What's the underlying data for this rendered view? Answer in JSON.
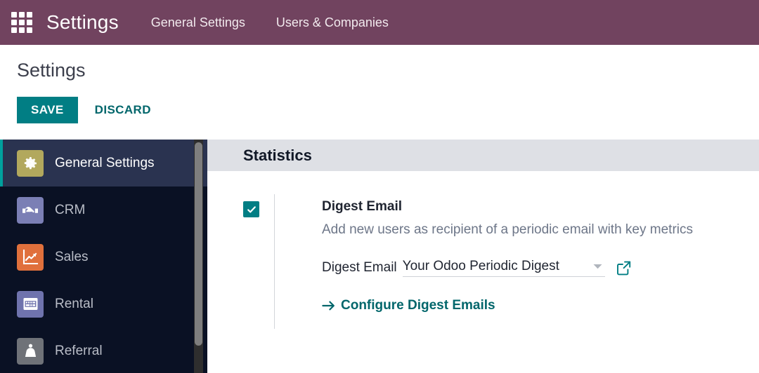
{
  "navbar": {
    "apps_icon": "apps-grid-icon",
    "brand": "Settings",
    "menu": [
      {
        "label": "General Settings"
      },
      {
        "label": "Users & Companies"
      }
    ],
    "background_color": "#71435f"
  },
  "control_panel": {
    "title": "Settings",
    "save_label": "SAVE",
    "discard_label": "DISCARD",
    "accent_color": "#017e84"
  },
  "sidebar": {
    "background_color": "#0a1124",
    "active_background_color": "#2a3350",
    "active_border_color": "#00a09d",
    "items": [
      {
        "label": "General Settings",
        "icon": "gear-icon",
        "icon_bg": "#b2a85d",
        "active": true
      },
      {
        "label": "CRM",
        "icon": "handshake-icon",
        "icon_bg": "#7b7fb5",
        "active": false
      },
      {
        "label": "Sales",
        "icon": "chart-arrow-icon",
        "icon_bg": "#e0703c",
        "active": false
      },
      {
        "label": "Rental",
        "icon": "calendar-icon",
        "icon_bg": "#6f73ad",
        "active": false
      },
      {
        "label": "Referral",
        "icon": "person-cape-icon",
        "icon_bg": "#6f7278",
        "active": false
      }
    ],
    "scrollbar": "vertical-scrollbar"
  },
  "content": {
    "section_title": "Statistics",
    "digest": {
      "checkbox_checked": true,
      "checkbox_icon": "check-icon",
      "label": "Digest Email",
      "description": "Add new users as recipient of a periodic email with key metrics",
      "field_label": "Digest Email",
      "field_value": "Your Odoo Periodic Digest",
      "field_caret_icon": "chevron-down-icon",
      "field_external_icon": "external-link-icon",
      "configure_link": "Configure Digest Emails",
      "configure_arrow_icon": "arrow-right-icon"
    }
  }
}
